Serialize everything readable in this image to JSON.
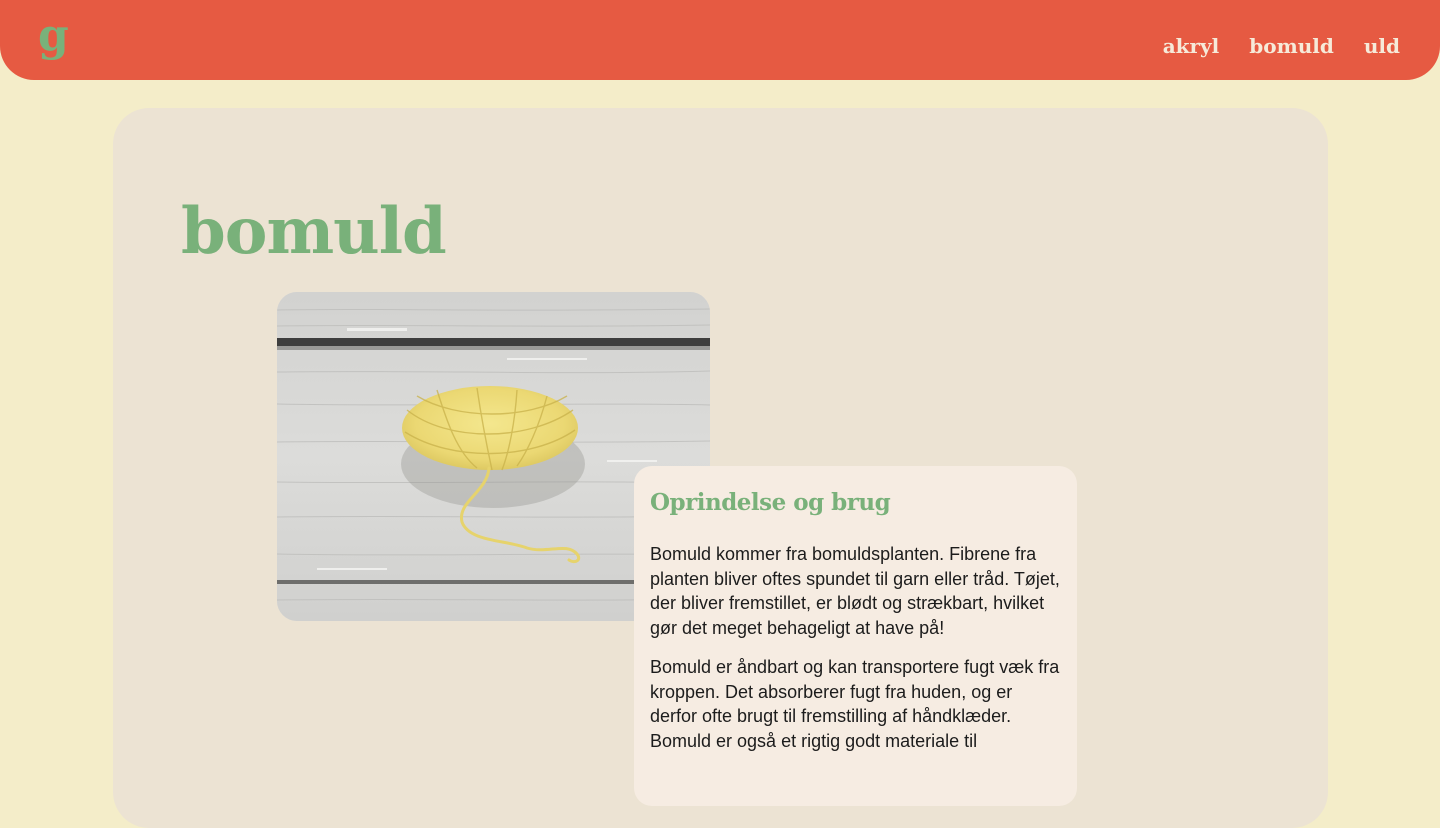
{
  "header": {
    "logo": "g",
    "nav": [
      {
        "label": "akryl"
      },
      {
        "label": "bomuld"
      },
      {
        "label": "uld"
      }
    ]
  },
  "main": {
    "title": "bomuld",
    "image": {
      "icon": "yarn-ball-photo"
    },
    "info": {
      "heading": "Oprindelse og brug",
      "paragraphs": [
        "Bomuld kommer fra bomuldsplanten. Fibrene fra planten bliver oftes spundet til garn eller tråd. Tøjet, der bliver fremstillet, er blødt og strækbart, hvilket gør det meget behageligt at have på!",
        "Bomuld er åndbart og kan transportere fugt væk fra kroppen. Det absorberer fugt fra huden, og er derfor ofte brugt til fremstilling af håndklæder. Bomuld er også et rigtig godt materiale til"
      ]
    }
  },
  "colors": {
    "page_background": "#F4EDC9",
    "header_background": "#E65A42",
    "accent_green": "#79B17A",
    "nav_text": "#F6EAD9",
    "card_background": "#ECE3D3",
    "info_background": "#F6ECE2",
    "body_text": "#1C1C1C"
  }
}
